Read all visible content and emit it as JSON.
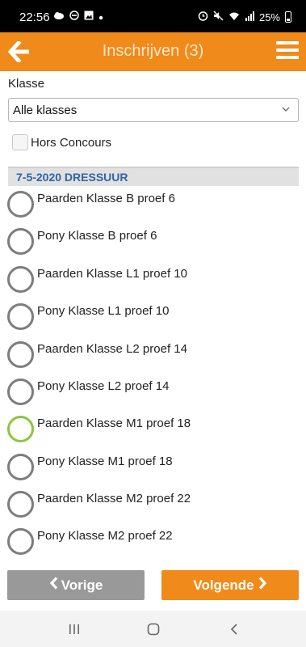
{
  "status_bar": {
    "time": "22:56",
    "battery": "25%",
    "left_icons": [
      "cloud-icon",
      "dnd-icon",
      "image-icon",
      "dot-icon"
    ],
    "right_icons": [
      "alarm-icon",
      "mute-icon",
      "wifi-icon",
      "signal-icon",
      "battery-icon"
    ]
  },
  "header": {
    "title": "Inschrijven (3)",
    "color": "#f08a1a"
  },
  "form": {
    "klasse_label": "Klasse",
    "klasse_value": "Alle klasses",
    "hors_concours_label": "Hors Concours",
    "hors_concours_checked": false
  },
  "section": {
    "title": "7-5-2020 DRESSUUR",
    "options": [
      {
        "label": "Paarden Klasse B proef 6",
        "highlight": false
      },
      {
        "label": "Pony Klasse B proef 6",
        "highlight": false
      },
      {
        "label": "Paarden Klasse L1 proef 10",
        "highlight": false
      },
      {
        "label": "Pony Klasse L1 proef 10",
        "highlight": false
      },
      {
        "label": "Paarden Klasse L2 proef 14",
        "highlight": false
      },
      {
        "label": "Pony Klasse L2 proef 14",
        "highlight": false
      },
      {
        "label": "Paarden Klasse M1 proef 18",
        "highlight": true
      },
      {
        "label": "Pony Klasse M1 proef 18",
        "highlight": false
      },
      {
        "label": "Paarden Klasse M2 proef 22",
        "highlight": false
      },
      {
        "label": "Pony Klasse M2 proef 22",
        "highlight": false
      }
    ]
  },
  "buttons": {
    "prev": "Vorige",
    "next": "Volgende"
  },
  "nav": [
    "recent-apps-icon",
    "home-icon",
    "back-nav-icon"
  ]
}
